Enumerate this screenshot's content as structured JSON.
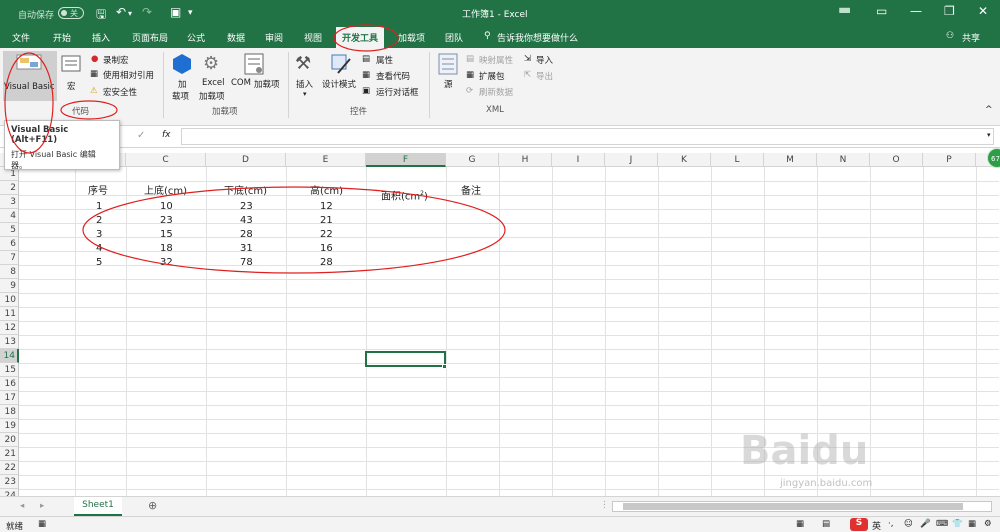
{
  "titlebar": {
    "autosave": "自动保存",
    "autosave_state": "关",
    "doc_title": "工作簿1  -  Excel"
  },
  "tabs": [
    "文件",
    "开始",
    "插入",
    "页面布局",
    "公式",
    "数据",
    "审阅",
    "视图",
    "开发工具",
    "加载项",
    "团队"
  ],
  "tell_me": "告诉我你想要做什么",
  "share": "共享",
  "ribbon": {
    "code": {
      "vb": "Visual Basic",
      "macros": "宏",
      "record": "录制宏",
      "relative": "使用相对引用",
      "security": "宏安全性",
      "label": "代码"
    },
    "addins": {
      "addin_a": "加",
      "addin_b": "载项",
      "excel_a": "Excel",
      "excel_b": "加载项",
      "com_a": "COM",
      "com_b": "加载项",
      "label": "加载项"
    },
    "controls": {
      "insert": "插入",
      "design": "设计模式",
      "properties": "属性",
      "view_code": "查看代码",
      "run_dialog": "运行对话框",
      "label": "控件"
    },
    "xml": {
      "source": "源",
      "map_props": "映射属性",
      "expansion": "扩展包",
      "refresh": "刷新数据",
      "import": "导入",
      "export": "导出",
      "label": "XML"
    }
  },
  "tooltip": {
    "title": "Visual Basic (Alt+F11)",
    "body1": "打开 Visual Basic 编辑",
    "body2": "器。"
  },
  "columns": [
    "C",
    "D",
    "E",
    "F",
    "G",
    "H",
    "I",
    "J",
    "K",
    "L",
    "M",
    "N",
    "O",
    "P"
  ],
  "rows": [
    "1",
    "2",
    "3",
    "4",
    "5",
    "6",
    "7",
    "8",
    "9",
    "10",
    "11",
    "12",
    "13",
    "14",
    "15",
    "16",
    "17",
    "18",
    "19",
    "20",
    "21",
    "22",
    "23",
    "24"
  ],
  "headers": {
    "seq": "序号",
    "top": "上底(cm)",
    "bottom": "下底(cm)",
    "height": "高(cm)",
    "area": "面积(cm",
    "area_sup": "2",
    "area_close": ")",
    "note": "备注"
  },
  "data": [
    [
      "1",
      "10",
      "23",
      "12"
    ],
    [
      "2",
      "23",
      "43",
      "21"
    ],
    [
      "3",
      "15",
      "28",
      "22"
    ],
    [
      "4",
      "18",
      "31",
      "16"
    ],
    [
      "5",
      "32",
      "78",
      "28"
    ]
  ],
  "sheet_tab": "Sheet1",
  "status": {
    "ready": "就绪"
  },
  "badge": "67",
  "watermark_url": "jingyan.baidu.com",
  "ime": "英",
  "colors": {
    "excel_green": "#217346",
    "annotation_red": "#e02020"
  }
}
